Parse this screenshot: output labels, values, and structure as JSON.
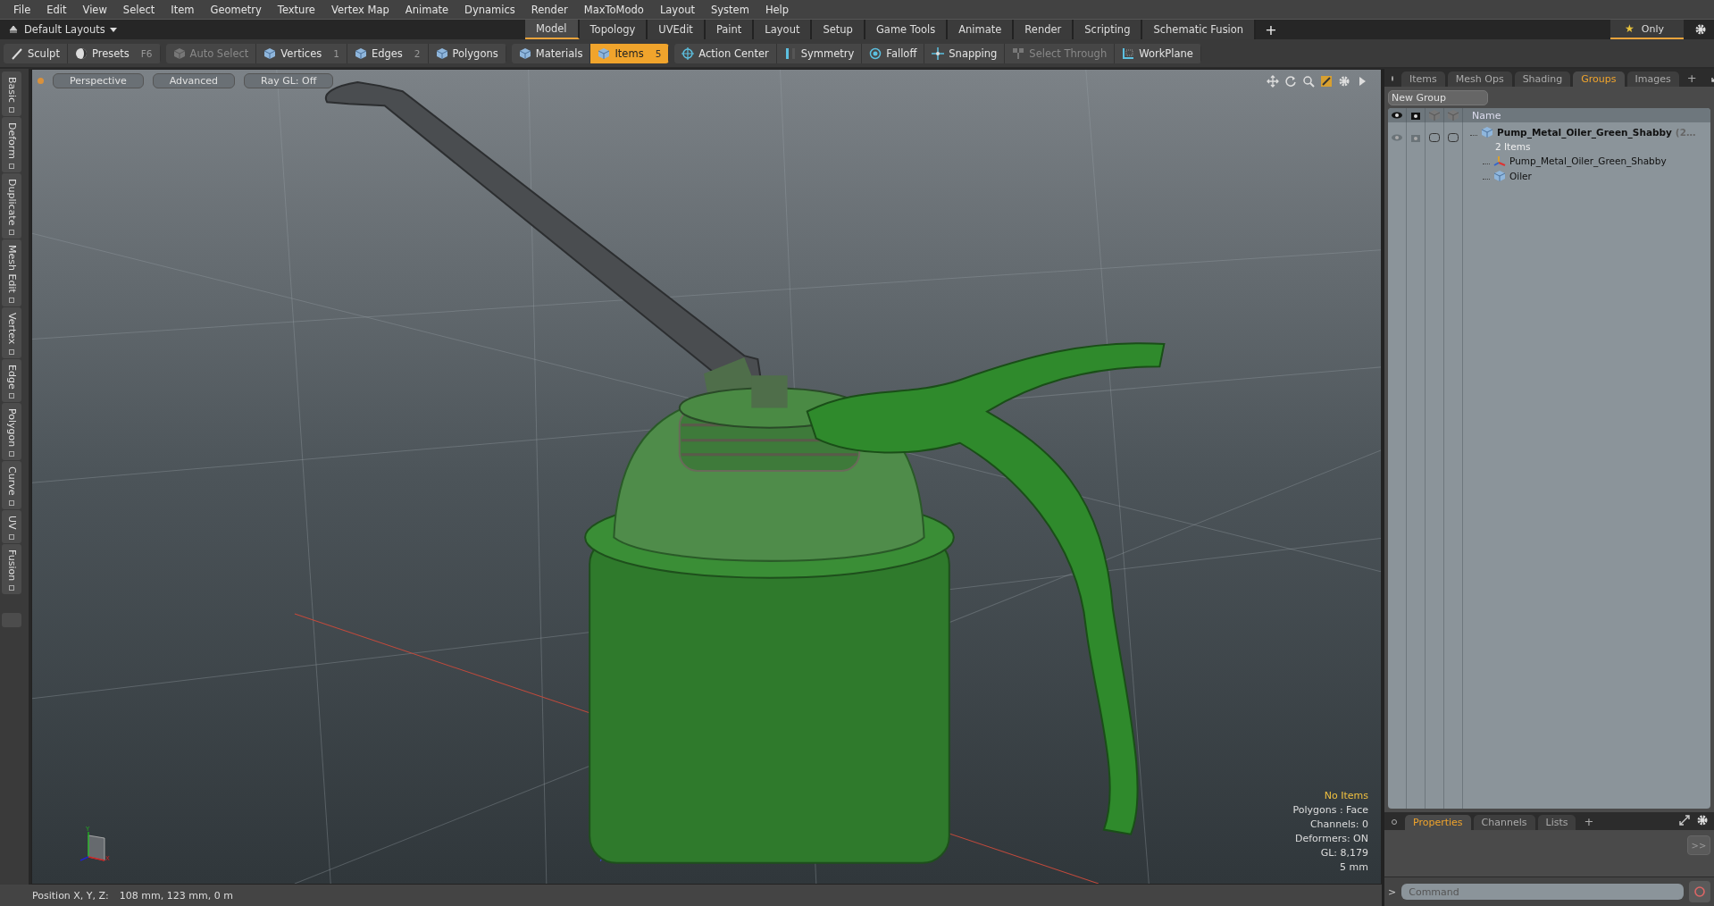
{
  "menu_bar": [
    "File",
    "Edit",
    "View",
    "Select",
    "Item",
    "Geometry",
    "Texture",
    "Vertex Map",
    "Animate",
    "Dynamics",
    "Render",
    "MaxToModo",
    "Layout",
    "System",
    "Help"
  ],
  "layout_bar": {
    "layouts_menu": "Default Layouts",
    "tabs": [
      {
        "label": "Model",
        "selected": true
      },
      {
        "label": "Topology",
        "selected": false
      },
      {
        "label": "UVEdit",
        "selected": false
      },
      {
        "label": "Paint",
        "selected": false
      },
      {
        "label": "Layout",
        "selected": false
      },
      {
        "label": "Setup",
        "selected": false
      },
      {
        "label": "Game Tools",
        "selected": false
      },
      {
        "label": "Animate",
        "selected": false
      },
      {
        "label": "Render",
        "selected": false
      },
      {
        "label": "Scripting",
        "selected": false
      },
      {
        "label": "Schematic Fusion",
        "selected": false
      }
    ],
    "add_tab": "+",
    "only_toggle": {
      "star": "★",
      "label": "Only"
    }
  },
  "toolbar": [
    [
      {
        "label": "Sculpt",
        "selected": false,
        "disabled": false
      },
      {
        "label": "Presets",
        "shortcut": "F6",
        "selected": false,
        "disabled": false
      }
    ],
    [
      {
        "label": "Auto Select",
        "selected": false,
        "disabled": true
      },
      {
        "label": "Vertices",
        "shortcut": "1",
        "selected": false,
        "disabled": false
      },
      {
        "label": "Edges",
        "shortcut": "2",
        "selected": false,
        "disabled": false
      },
      {
        "label": "Polygons",
        "selected": false,
        "disabled": false
      }
    ],
    [
      {
        "label": "Materials",
        "selected": false,
        "disabled": false
      },
      {
        "label": "Items",
        "shortcut": "5",
        "selected": true,
        "disabled": false
      }
    ],
    [
      {
        "label": "Action Center",
        "selected": false,
        "disabled": false
      },
      {
        "label": "Symmetry",
        "selected": false,
        "disabled": false
      },
      {
        "label": "Falloff",
        "selected": false,
        "disabled": false
      },
      {
        "label": "Snapping",
        "selected": false,
        "disabled": false
      },
      {
        "label": "Select Through",
        "selected": false,
        "disabled": true
      },
      {
        "label": "WorkPlane",
        "selected": false,
        "disabled": false
      }
    ]
  ],
  "side_tabs": [
    "Basic",
    "Deform",
    "Duplicate",
    "Mesh Edit",
    "Vertex",
    "Edge",
    "Polygon",
    "Curve",
    "UV",
    "Fusion"
  ],
  "viewport": {
    "view_buttons": [
      "Perspective",
      "Advanced",
      "Ray GL: Off"
    ],
    "info": [
      {
        "text": "No Items",
        "kind": "highlight"
      },
      {
        "text": "Polygons : Face",
        "kind": "plain"
      },
      {
        "text": "Channels: 0",
        "kind": "plain"
      },
      {
        "text": "Deformers: ON",
        "kind": "plain"
      },
      {
        "text": "GL: 8,179",
        "kind": "plain"
      },
      {
        "text": "5 mm",
        "kind": "plain"
      }
    ],
    "axis_labels": [
      "Y",
      "X"
    ]
  },
  "status_bar": {
    "label": "Position X, Y, Z:",
    "value": "108 mm, 123 mm, 0 m"
  },
  "right_panel": {
    "tabs": [
      {
        "label": "Items",
        "selected": false
      },
      {
        "label": "Mesh Ops",
        "selected": false
      },
      {
        "label": "Shading",
        "selected": false
      },
      {
        "label": "Groups",
        "selected": true
      },
      {
        "label": "Images",
        "selected": false
      }
    ],
    "add_tab": "+",
    "new_group": "New Group",
    "column_name": "Name",
    "tree": [
      {
        "name": "Pump_Metal_Oiler_Green_Shabby",
        "count": "(2…",
        "subtitle": "2 Items",
        "kind": "group",
        "children": [
          {
            "name": "Pump_Metal_Oiler_Green_Shabby",
            "kind": "locator"
          },
          {
            "name": "Oiler",
            "kind": "mesh"
          }
        ]
      }
    ]
  },
  "properties_panel": {
    "tabs": [
      {
        "label": "Properties",
        "selected": true
      },
      {
        "label": "Channels",
        "selected": false
      },
      {
        "label": "Lists",
        "selected": false
      }
    ],
    "add_tab": "+",
    "expand_button": ">>"
  },
  "command_bar": {
    "prompt": ">",
    "placeholder": "Command"
  }
}
